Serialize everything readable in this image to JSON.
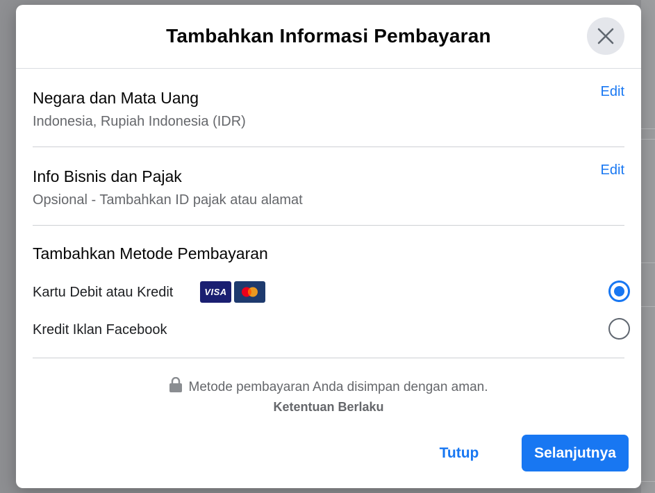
{
  "dialog": {
    "title": "Tambahkan Informasi Pembayaran",
    "close_icon": "close-icon"
  },
  "country_section": {
    "title": "Negara dan Mata Uang",
    "value": "Indonesia, Rupiah Indonesia (IDR)",
    "edit_label": "Edit"
  },
  "business_section": {
    "title": "Info Bisnis dan Pajak",
    "value": "Opsional - Tambahkan ID pajak atau alamat",
    "edit_label": "Edit"
  },
  "payment_methods": {
    "title": "Tambahkan Metode Pembayaran",
    "options": [
      {
        "label": "Kartu Debit atau Kredit",
        "selected": true,
        "badges": [
          "VISA",
          "mastercard-icon"
        ]
      },
      {
        "label": "Kredit Iklan Facebook",
        "selected": false
      }
    ]
  },
  "footer": {
    "secure_text": "Metode pembayaran Anda disimpan dengan aman.",
    "lock_icon": "lock-icon",
    "terms_label": "Ketentuan Berlaku",
    "close_button": "Tutup",
    "next_button": "Selanjutnya"
  },
  "colors": {
    "accent": "#1877f2",
    "text_primary": "#050505",
    "text_secondary": "#65676b",
    "visa_bg": "#1a1f71"
  }
}
